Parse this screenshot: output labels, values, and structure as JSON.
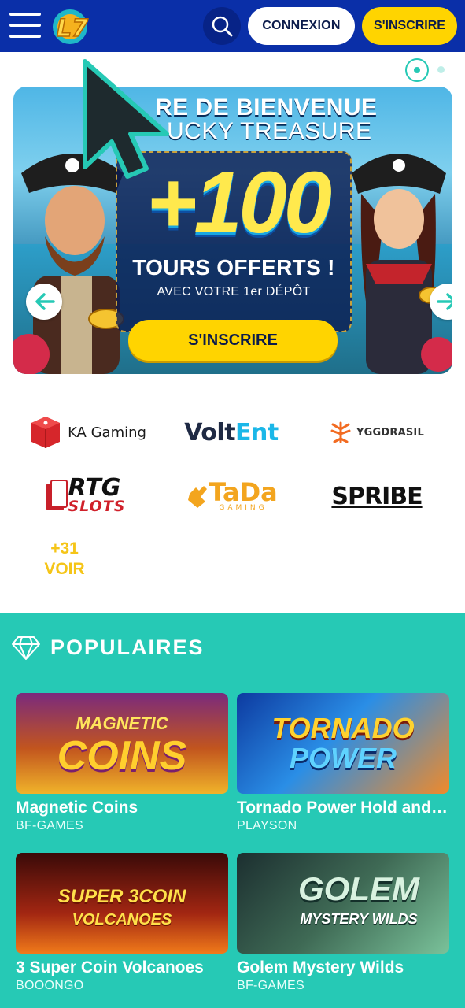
{
  "header": {
    "menu_icon": "hamburger-icon",
    "logo_text": "L7",
    "search_icon": "search-icon",
    "login_label": "CONNEXION",
    "signup_label": "S'INSCRIRE"
  },
  "carousel": {
    "slides_total": 2,
    "active_slide": 1
  },
  "banner": {
    "title_line1": "RE DE BIENVENUE",
    "title_line2": "UCKY TREASURE",
    "amount": "+100",
    "offer": "TOURS OFFERTS !",
    "condition": "AVEC VOTRE 1er DÉPÔT",
    "cta_label": "S'INSCRIRE",
    "prev_icon": "arrow-left-icon",
    "next_icon": "arrow-right-icon"
  },
  "providers": {
    "ka": "KA Gaming",
    "volt_main": "Volt",
    "volt_accent": "Ent",
    "ygg": "YGGDRASIL",
    "rtg_top": "RTG",
    "rtg_bottom": "SLOTS",
    "tada": "TaDa",
    "tada_sub": "GAMING",
    "spribe": "SPRIBE",
    "more_count": "+31",
    "more_label": "VOIR"
  },
  "populaires": {
    "icon": "diamond-icon",
    "title": "POPULAIRES",
    "games": [
      {
        "name": "Magnetic Coins",
        "provider": "BF-GAMES",
        "art_line1": "MAGNETIC",
        "art_line2": "COINS"
      },
      {
        "name": "Tornado Power Hold and Win",
        "provider": "PLAYSON",
        "art_line1": "TORNADO",
        "art_line2": "POWER"
      },
      {
        "name": "3 Super Coin Volcanoes",
        "provider": "BOOONGO",
        "art_line1": "SUPER 3COIN",
        "art_line2": "VOLCANOES"
      },
      {
        "name": "Golem Mystery Wilds",
        "provider": "BF-GAMES",
        "art_line1": "GOLEM",
        "art_line2": "MYSTERY WILDS"
      }
    ]
  },
  "colors": {
    "header_bg": "#0a2fa8",
    "accent_yellow": "#ffd400",
    "teal": "#26c9b5"
  }
}
